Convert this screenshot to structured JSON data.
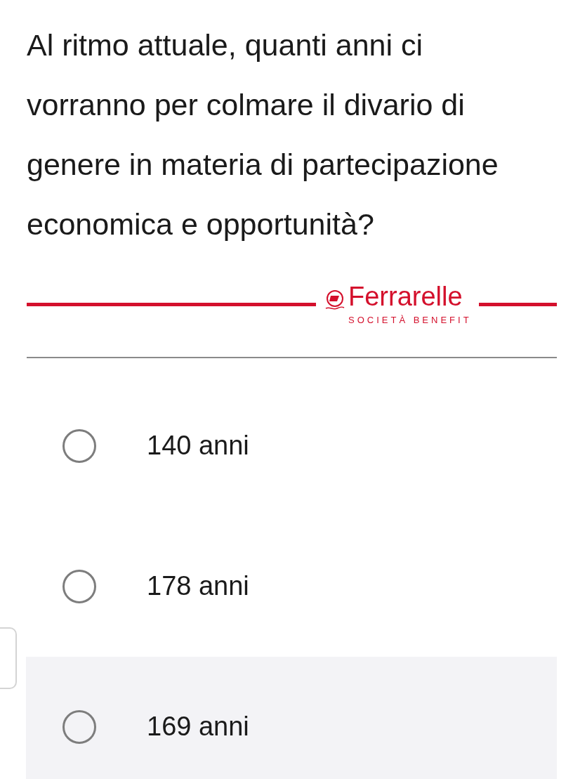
{
  "question": "Al ritmo attuale, quanti anni ci vorranno per colmare il divario di genere in materia di partecipazione economica e opportunità?",
  "logo": {
    "name": "Ferrarelle",
    "tagline": "SOCIETÀ BENEFIT"
  },
  "options": [
    {
      "label": "140 anni",
      "selected": false,
      "highlighted": false
    },
    {
      "label": "178 anni",
      "selected": false,
      "highlighted": false
    },
    {
      "label": "169 anni",
      "selected": false,
      "highlighted": true
    }
  ]
}
